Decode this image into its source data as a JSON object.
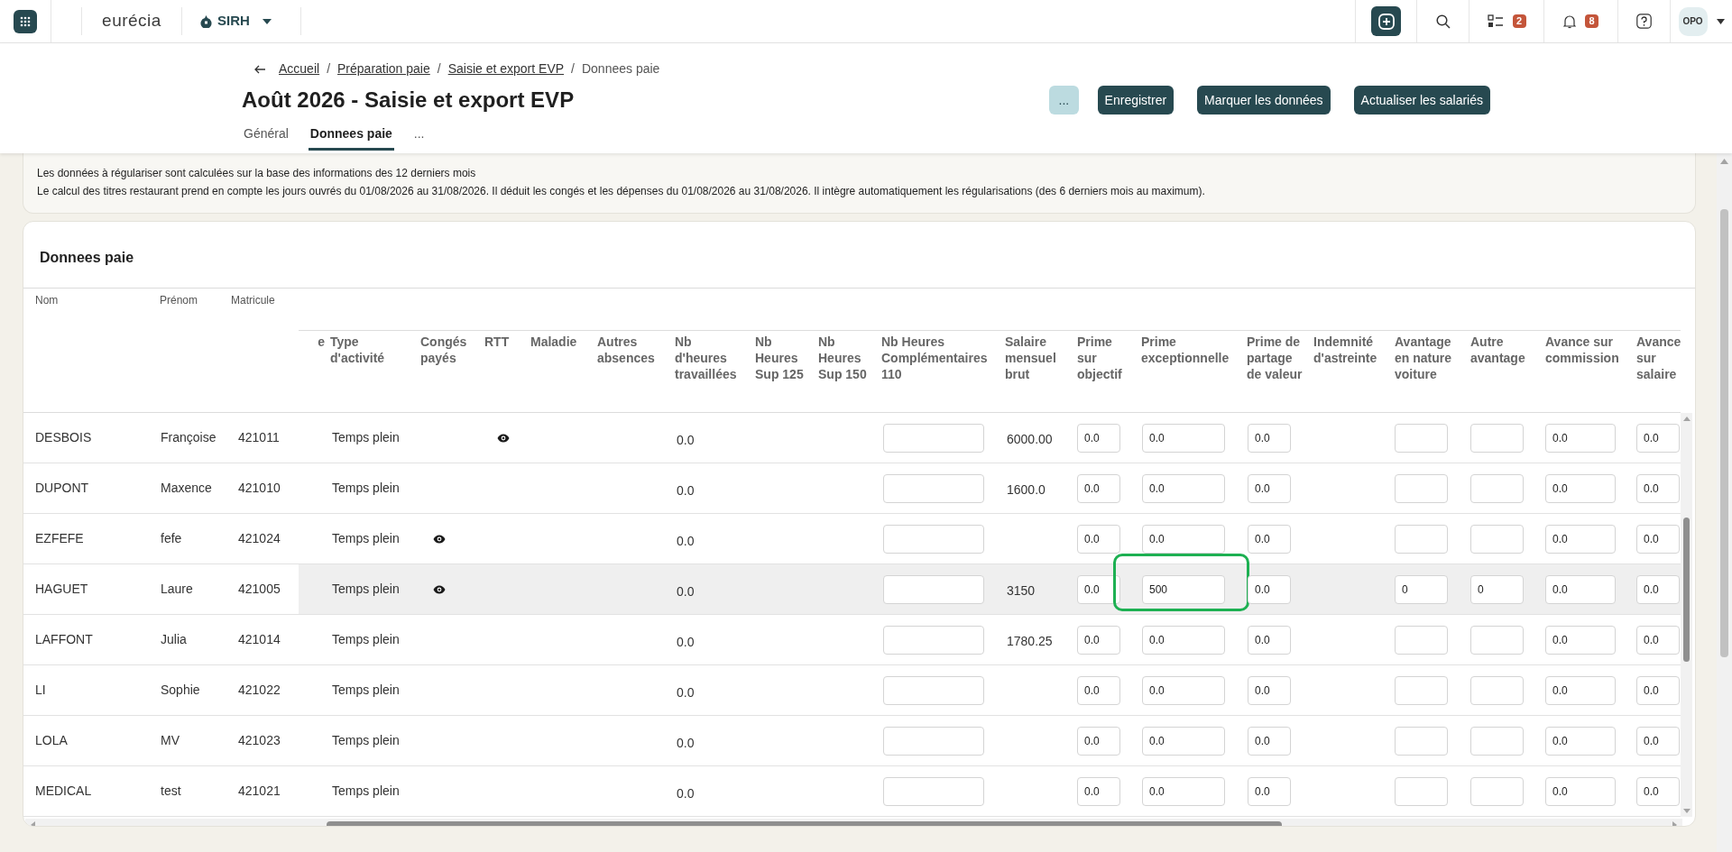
{
  "topbar": {
    "logo": "eurécia",
    "module": "SIRH",
    "badges": [
      {
        "count": "2"
      },
      {
        "count": "8"
      }
    ],
    "avatar": "OPO"
  },
  "breadcrumb": [
    {
      "label": "Accueil",
      "link": true,
      "separator": "/"
    },
    {
      "label": "Préparation paie",
      "link": true,
      "separator": "/"
    },
    {
      "label": "Saisie et export EVP",
      "link": true,
      "separator": "/"
    },
    {
      "label": "Donnees paie",
      "link": false
    }
  ],
  "title": "Août 2026 - Saisie et export EVP",
  "actions": [
    {
      "label": "...",
      "kind": "secondary"
    },
    {
      "label": "Enregistrer",
      "kind": "primary"
    },
    {
      "label": "Marquer les données",
      "kind": "primary"
    },
    {
      "label": "Actualiser les salariés",
      "kind": "primary"
    }
  ],
  "tabs": [
    {
      "label": "Général",
      "selected": false
    },
    {
      "label": "Donnees paie",
      "selected": true
    },
    {
      "label": "...",
      "selected": false
    }
  ],
  "info_lines": [
    "Les données à régulariser sont calculées sur la base des informations des 12 derniers mois",
    "Le calcul des titres restaurant prend en compte les jours ouvrés du 01/08/2026 au 31/08/2026. Il déduit les congés et les dépenses du 01/08/2026 au 31/08/2026. Il intègre automatiquement les régularisations (des 6 derniers mois au maximum)."
  ],
  "card_title": "Donnees paie",
  "table": {
    "fixed_columns": [
      "Nom",
      "Prénom",
      "Matricule"
    ],
    "columns": [
      "e",
      "Type d'activité",
      "Congés payés",
      "RTT",
      "Maladie",
      "Autres absences",
      "Nb d'heures travaillées",
      "Nb Heures Sup 125",
      "Nb Heures Sup 150",
      "Nb Heures Complémentaires 110",
      "Salaire mensuel brut",
      "Prime sur objectif",
      "Prime exceptionnelle",
      "Prime de partage de valeur",
      "Indemnité d'astreinte",
      "Avantage en nature voiture",
      "Autre avantage",
      "Avance sur commission",
      "Avance sur salaire"
    ],
    "rows": [
      {
        "nom": "DESBOIS",
        "prenom": "Françoise",
        "matricule": "421011",
        "highlighted": false,
        "cells": [
          {
            "kind": "blank"
          },
          {
            "kind": "text",
            "text": "Temps plein"
          },
          {
            "kind": "blank"
          },
          {
            "kind": "eye"
          },
          {
            "kind": "blank"
          },
          {
            "kind": "blank"
          },
          {
            "kind": "text",
            "text": "0.0"
          },
          {
            "kind": "blank"
          },
          {
            "kind": "blank"
          },
          {
            "kind": "input"
          },
          {
            "kind": "text",
            "text": "6000.00"
          },
          {
            "kind": "input",
            "value": "0.0"
          },
          {
            "kind": "input",
            "value": "0.0"
          },
          {
            "kind": "input",
            "value": "0.0"
          },
          {
            "kind": "blank"
          },
          {
            "kind": "input"
          },
          {
            "kind": "input"
          },
          {
            "kind": "input",
            "value": "0.0"
          },
          {
            "kind": "input",
            "value": "0.0"
          }
        ]
      },
      {
        "nom": "DUPONT",
        "prenom": "Maxence",
        "matricule": "421010",
        "highlighted": false,
        "cells": [
          {
            "kind": "blank"
          },
          {
            "kind": "text",
            "text": "Temps plein"
          },
          {
            "kind": "blank"
          },
          {
            "kind": "blank"
          },
          {
            "kind": "blank"
          },
          {
            "kind": "blank"
          },
          {
            "kind": "text",
            "text": "0.0"
          },
          {
            "kind": "blank"
          },
          {
            "kind": "blank"
          },
          {
            "kind": "input"
          },
          {
            "kind": "text",
            "text": "1600.0"
          },
          {
            "kind": "input",
            "value": "0.0"
          },
          {
            "kind": "input",
            "value": "0.0"
          },
          {
            "kind": "input",
            "value": "0.0"
          },
          {
            "kind": "blank"
          },
          {
            "kind": "input"
          },
          {
            "kind": "input"
          },
          {
            "kind": "input",
            "value": "0.0"
          },
          {
            "kind": "input",
            "value": "0.0"
          }
        ]
      },
      {
        "nom": "EZFEFE",
        "prenom": "fefe",
        "matricule": "421024",
        "highlighted": false,
        "cells": [
          {
            "kind": "blank"
          },
          {
            "kind": "text",
            "text": "Temps plein"
          },
          {
            "kind": "eye"
          },
          {
            "kind": "blank"
          },
          {
            "kind": "blank"
          },
          {
            "kind": "blank"
          },
          {
            "kind": "text",
            "text": "0.0"
          },
          {
            "kind": "blank"
          },
          {
            "kind": "blank"
          },
          {
            "kind": "input"
          },
          {
            "kind": "blank"
          },
          {
            "kind": "input",
            "value": "0.0"
          },
          {
            "kind": "input",
            "value": "0.0"
          },
          {
            "kind": "input",
            "value": "0.0"
          },
          {
            "kind": "blank"
          },
          {
            "kind": "input"
          },
          {
            "kind": "input"
          },
          {
            "kind": "input",
            "value": "0.0"
          },
          {
            "kind": "input",
            "value": "0.0"
          }
        ]
      },
      {
        "nom": "HAGUET",
        "prenom": "Laure",
        "matricule": "421005",
        "highlighted": true,
        "cells": [
          {
            "kind": "blank"
          },
          {
            "kind": "text",
            "text": "Temps plein"
          },
          {
            "kind": "eye"
          },
          {
            "kind": "blank"
          },
          {
            "kind": "blank"
          },
          {
            "kind": "blank"
          },
          {
            "kind": "text",
            "text": "0.0"
          },
          {
            "kind": "blank"
          },
          {
            "kind": "blank"
          },
          {
            "kind": "input"
          },
          {
            "kind": "text",
            "text": "3150"
          },
          {
            "kind": "input",
            "value": "0.0"
          },
          {
            "kind": "input",
            "value": "500",
            "framed": true
          },
          {
            "kind": "input",
            "value": "0.0"
          },
          {
            "kind": "blank"
          },
          {
            "kind": "input",
            "value": "0"
          },
          {
            "kind": "input",
            "value": "0"
          },
          {
            "kind": "input",
            "value": "0.0"
          },
          {
            "kind": "input",
            "value": "0.0"
          }
        ]
      },
      {
        "nom": "LAFFONT",
        "prenom": "Julia",
        "matricule": "421014",
        "highlighted": false,
        "cells": [
          {
            "kind": "blank"
          },
          {
            "kind": "text",
            "text": "Temps plein"
          },
          {
            "kind": "blank"
          },
          {
            "kind": "blank"
          },
          {
            "kind": "blank"
          },
          {
            "kind": "blank"
          },
          {
            "kind": "text",
            "text": "0.0"
          },
          {
            "kind": "blank"
          },
          {
            "kind": "blank"
          },
          {
            "kind": "input"
          },
          {
            "kind": "text",
            "text": "1780.25"
          },
          {
            "kind": "input",
            "value": "0.0"
          },
          {
            "kind": "input",
            "value": "0.0"
          },
          {
            "kind": "input",
            "value": "0.0"
          },
          {
            "kind": "blank"
          },
          {
            "kind": "input"
          },
          {
            "kind": "input"
          },
          {
            "kind": "input",
            "value": "0.0"
          },
          {
            "kind": "input",
            "value": "0.0"
          }
        ]
      },
      {
        "nom": "LI",
        "prenom": "Sophie",
        "matricule": "421022",
        "highlighted": false,
        "cells": [
          {
            "kind": "blank"
          },
          {
            "kind": "text",
            "text": "Temps plein"
          },
          {
            "kind": "blank"
          },
          {
            "kind": "blank"
          },
          {
            "kind": "blank"
          },
          {
            "kind": "blank"
          },
          {
            "kind": "text",
            "text": "0.0"
          },
          {
            "kind": "blank"
          },
          {
            "kind": "blank"
          },
          {
            "kind": "input"
          },
          {
            "kind": "blank"
          },
          {
            "kind": "input",
            "value": "0.0"
          },
          {
            "kind": "input",
            "value": "0.0"
          },
          {
            "kind": "input",
            "value": "0.0"
          },
          {
            "kind": "blank"
          },
          {
            "kind": "input"
          },
          {
            "kind": "input"
          },
          {
            "kind": "input",
            "value": "0.0"
          },
          {
            "kind": "input",
            "value": "0.0"
          }
        ]
      },
      {
        "nom": "LOLA",
        "prenom": "MV",
        "matricule": "421023",
        "highlighted": false,
        "cells": [
          {
            "kind": "blank"
          },
          {
            "kind": "text",
            "text": "Temps plein"
          },
          {
            "kind": "blank"
          },
          {
            "kind": "blank"
          },
          {
            "kind": "blank"
          },
          {
            "kind": "blank"
          },
          {
            "kind": "text",
            "text": "0.0"
          },
          {
            "kind": "blank"
          },
          {
            "kind": "blank"
          },
          {
            "kind": "input"
          },
          {
            "kind": "blank"
          },
          {
            "kind": "input",
            "value": "0.0"
          },
          {
            "kind": "input",
            "value": "0.0"
          },
          {
            "kind": "input",
            "value": "0.0"
          },
          {
            "kind": "blank"
          },
          {
            "kind": "input"
          },
          {
            "kind": "input"
          },
          {
            "kind": "input",
            "value": "0.0"
          },
          {
            "kind": "input",
            "value": "0.0"
          }
        ]
      },
      {
        "nom": "MEDICAL",
        "prenom": "test",
        "matricule": "421021",
        "highlighted": false,
        "cells": [
          {
            "kind": "blank"
          },
          {
            "kind": "text",
            "text": "Temps plein"
          },
          {
            "kind": "blank"
          },
          {
            "kind": "blank"
          },
          {
            "kind": "blank"
          },
          {
            "kind": "blank"
          },
          {
            "kind": "text",
            "text": "0.0"
          },
          {
            "kind": "blank"
          },
          {
            "kind": "blank"
          },
          {
            "kind": "input"
          },
          {
            "kind": "blank"
          },
          {
            "kind": "input",
            "value": "0.0"
          },
          {
            "kind": "input",
            "value": "0.0"
          },
          {
            "kind": "input",
            "value": "0.0"
          },
          {
            "kind": "blank"
          },
          {
            "kind": "input"
          },
          {
            "kind": "input"
          },
          {
            "kind": "input",
            "value": "0.0"
          },
          {
            "kind": "input",
            "value": "0.0"
          }
        ]
      }
    ]
  }
}
